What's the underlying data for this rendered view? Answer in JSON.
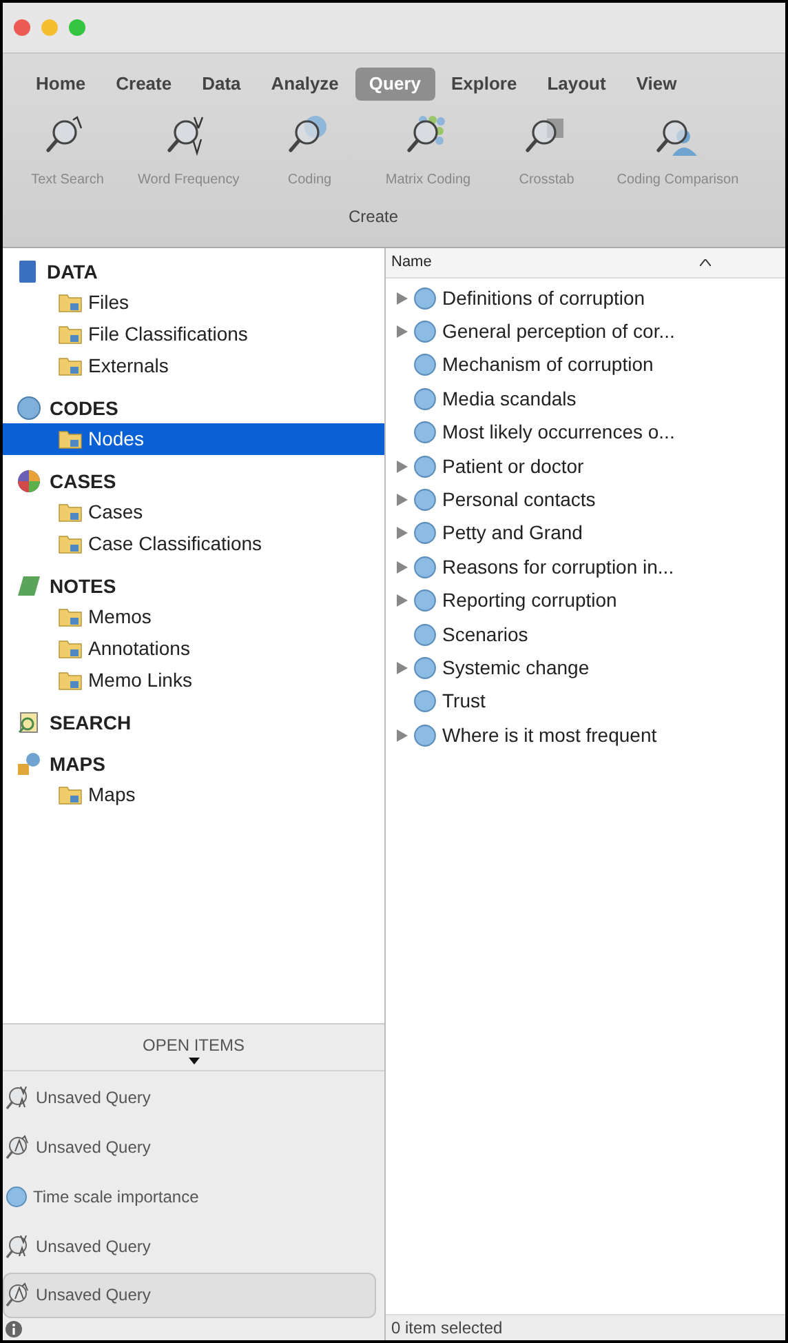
{
  "menu_tabs": [
    {
      "label": "Home",
      "selected": false
    },
    {
      "label": "Create",
      "selected": false
    },
    {
      "label": "Data",
      "selected": false
    },
    {
      "label": "Analyze",
      "selected": false
    },
    {
      "label": "Query",
      "selected": true
    },
    {
      "label": "Explore",
      "selected": false
    },
    {
      "label": "Layout",
      "selected": false
    },
    {
      "label": "View",
      "selected": false
    }
  ],
  "ribbon": {
    "buttons": [
      {
        "kind": "text",
        "label": "Text Search"
      },
      {
        "kind": "word",
        "label": "Word Frequency"
      },
      {
        "kind": "coding",
        "label": "Coding"
      },
      {
        "kind": "matrix",
        "label": "Matrix Coding"
      },
      {
        "kind": "crosstab",
        "label": "Crosstab"
      },
      {
        "kind": "comparison",
        "label": "Coding Comparison"
      }
    ],
    "group_label": "Create"
  },
  "sidebar": {
    "sections": [
      {
        "kind": "data",
        "title": "DATA",
        "items": [
          {
            "label": "Files",
            "selected": false
          },
          {
            "label": "File Classifications",
            "selected": false
          },
          {
            "label": "Externals",
            "selected": false
          }
        ]
      },
      {
        "kind": "codes",
        "title": "CODES",
        "items": [
          {
            "label": "Nodes",
            "selected": true
          }
        ]
      },
      {
        "kind": "cases",
        "title": "CASES",
        "items": [
          {
            "label": "Cases",
            "selected": false
          },
          {
            "label": "Case Classifications",
            "selected": false
          }
        ]
      },
      {
        "kind": "notes",
        "title": "NOTES",
        "items": [
          {
            "label": "Memos",
            "selected": false
          },
          {
            "label": "Annotations",
            "selected": false
          },
          {
            "label": "Memo Links",
            "selected": false
          }
        ]
      },
      {
        "kind": "search",
        "title": "SEARCH"
      },
      {
        "kind": "maps",
        "title": "MAPS",
        "items": [
          {
            "label": "Maps",
            "selected": false
          }
        ]
      }
    ]
  },
  "open_items": {
    "title": "OPEN ITEMS",
    "items": [
      {
        "kind": "word",
        "label": "Unsaved Query",
        "selected": false
      },
      {
        "kind": "text",
        "label": "Unsaved Query",
        "selected": false
      },
      {
        "kind": "node",
        "label": "Time scale importance",
        "selected": false
      },
      {
        "kind": "word",
        "label": "Unsaved Query",
        "selected": false
      },
      {
        "kind": "text",
        "label": "Unsaved Query",
        "selected": true
      }
    ]
  },
  "table": {
    "column": "Name",
    "rows": [
      {
        "label": "Definitions of corruption",
        "expandable": true
      },
      {
        "label": "General perception of cor...",
        "expandable": true
      },
      {
        "label": "Mechanism of corruption",
        "expandable": false
      },
      {
        "label": "Media scandals",
        "expandable": false
      },
      {
        "label": "Most likely occurrences o...",
        "expandable": false
      },
      {
        "label": "Patient or doctor",
        "expandable": true
      },
      {
        "label": "Personal contacts",
        "expandable": true
      },
      {
        "label": "Petty and Grand",
        "expandable": true
      },
      {
        "label": "Reasons for corruption in...",
        "expandable": true
      },
      {
        "label": "Reporting corruption",
        "expandable": true
      },
      {
        "label": "Scenarios",
        "expandable": false
      },
      {
        "label": "Systemic change",
        "expandable": true
      },
      {
        "label": "Trust",
        "expandable": false
      },
      {
        "label": "Where is it most frequent",
        "expandable": true
      }
    ]
  },
  "status_bar": "0 item selected"
}
